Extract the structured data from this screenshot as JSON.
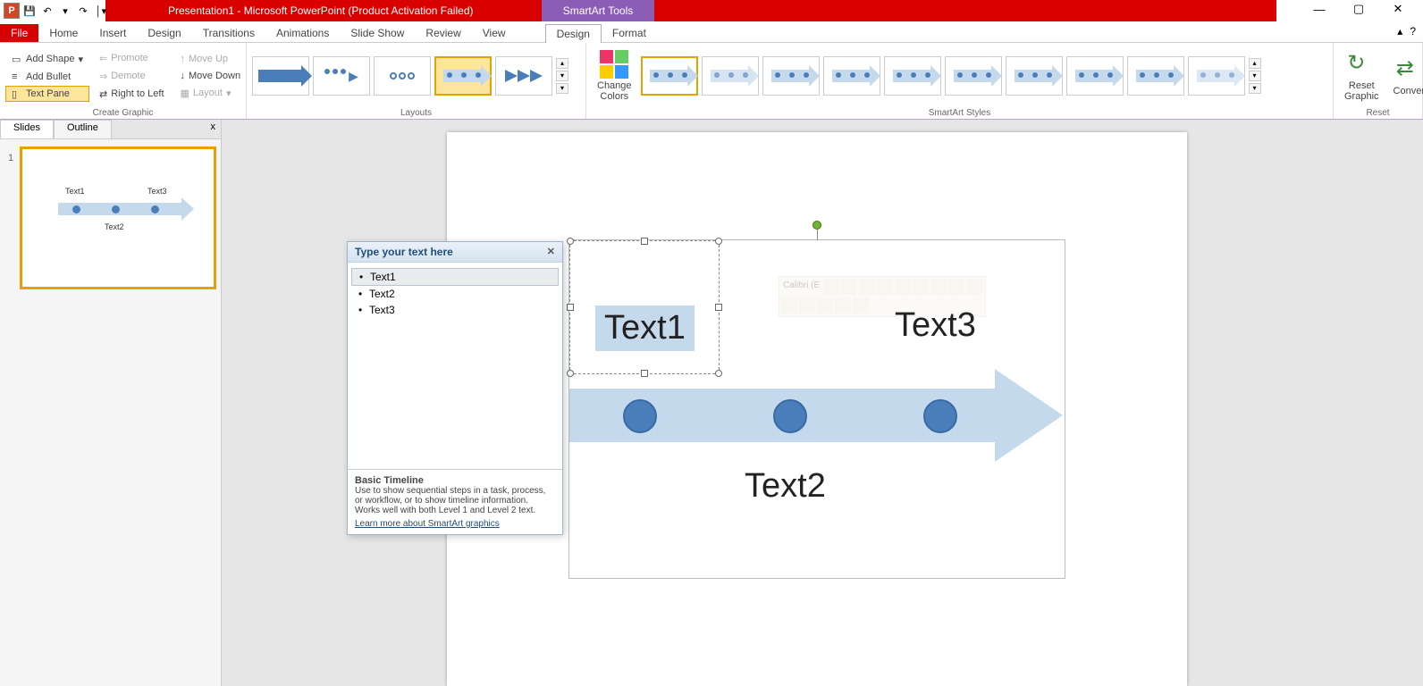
{
  "app": {
    "logo": "P",
    "title": "Presentation1 - Microsoft PowerPoint (Product Activation Failed)",
    "tools_tab": "SmartArt Tools"
  },
  "qat": {
    "save": "💾",
    "undo": "↶",
    "redo": "↷",
    "more": "▾"
  },
  "win": {
    "min": "—",
    "max": "▢",
    "close": "✕"
  },
  "tabs": {
    "file": "File",
    "home": "Home",
    "insert": "Insert",
    "design": "Design",
    "transitions": "Transitions",
    "animations": "Animations",
    "slideshow": "Slide Show",
    "review": "Review",
    "view": "View",
    "sa_design": "Design",
    "sa_format": "Format"
  },
  "ribbon_help": {
    "collapse": "▴",
    "help": "?"
  },
  "create_graphic": {
    "add_shape": "Add Shape",
    "add_bullet": "Add Bullet",
    "text_pane": "Text Pane",
    "promote": "Promote",
    "demote": "Demote",
    "right_to_left": "Right to Left",
    "move_up": "Move Up",
    "move_down": "Move Down",
    "layout": "Layout",
    "label": "Create Graphic"
  },
  "layouts": {
    "label": "Layouts"
  },
  "smartart_styles": {
    "change_colors": "Change\nColors",
    "label": "SmartArt Styles"
  },
  "reset": {
    "reset_graphic": "Reset\nGraphic",
    "convert": "Convert",
    "label": "Reset"
  },
  "left_panel": {
    "slides": "Slides",
    "outline": "Outline",
    "close": "x",
    "slide_num": "1"
  },
  "thumb": {
    "t1": "Text1",
    "t2": "Text2",
    "t3": "Text3"
  },
  "smartart": {
    "text1": "Text1",
    "text2": "Text2",
    "text3": "Text3"
  },
  "text_pane": {
    "header": "Type your text here",
    "items": [
      "Text1",
      "Text2",
      "Text3"
    ],
    "info_title": "Basic Timeline",
    "info_desc": "Use to show sequential steps in a task, process, or workflow, or to show timeline information. Works well with both Level 1 and Level 2 text.",
    "link": "Learn more about SmartArt graphics"
  },
  "mini_toolbar": {
    "font": "Calibri (E"
  }
}
